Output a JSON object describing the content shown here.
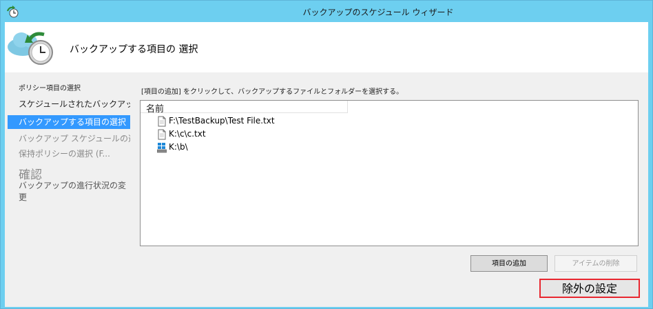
{
  "window": {
    "title": "バックアップのスケジュール ウィザード"
  },
  "header": {
    "heading": "バックアップする項目の 選択"
  },
  "sidebar": {
    "section_title": "ポリシー項目の選択",
    "items": [
      {
        "label": "スケジュールされたバックアップを..."
      },
      {
        "label": "バックアップする項目の選択"
      },
      {
        "label": "バックアップ スケジュールの選択 ..."
      },
      {
        "label": "保持ポリシーの選択 (F..."
      }
    ],
    "confirm_label": "確認",
    "progress_label": "バックアップの進行状況の変更"
  },
  "main": {
    "instruction": "[項目の追加] をクリックして、バックアップするファイルとフォルダーを選択する。",
    "list": {
      "column_name": "名前",
      "rows": [
        {
          "label": "F:\\TestBackup\\Test File.txt",
          "icon": "file-icon"
        },
        {
          "label": "K:\\c\\c.txt",
          "icon": "file-icon"
        },
        {
          "label": "K:\\b\\",
          "icon": "drive-icon"
        }
      ]
    },
    "buttons": {
      "add": "項目の追加",
      "remove": "アイテムの削除",
      "exclusions": "除外の設定"
    }
  },
  "colors": {
    "titlebar": "#6dcff0",
    "selection": "#3399ff",
    "highlight_border": "#e8262f"
  }
}
